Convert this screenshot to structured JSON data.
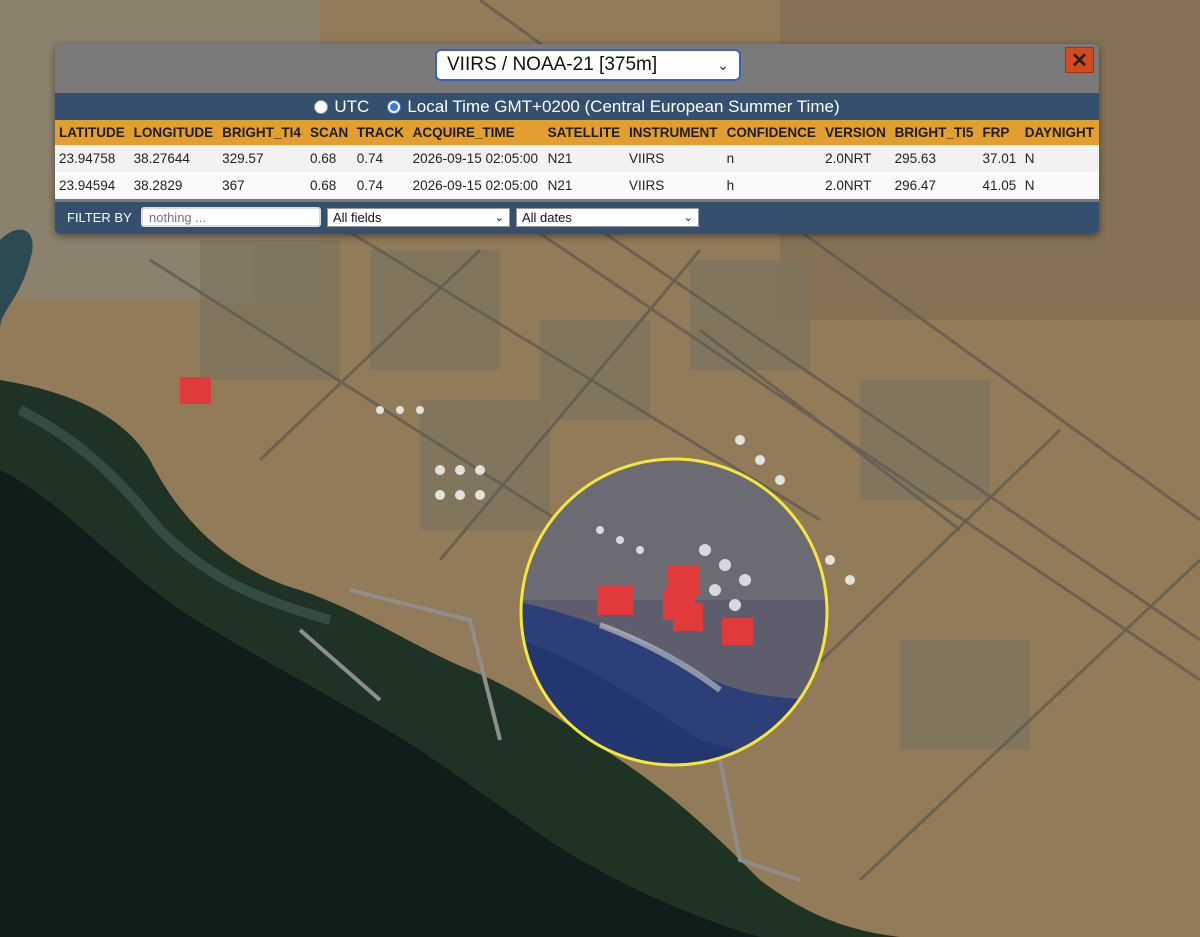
{
  "panel": {
    "source_select": "VIIRS / NOAA-21 [375m]",
    "close_label": "✕",
    "timezone": {
      "utc_label": "UTC",
      "local_label": "Local Time GMT+0200 (Central European Summer Time)",
      "selected": "local"
    },
    "table": {
      "columns": [
        "LATITUDE",
        "LONGITUDE",
        "BRIGHT_TI4",
        "SCAN",
        "TRACK",
        "ACQUIRE_TIME",
        "SATELLITE",
        "INSTRUMENT",
        "CONFIDENCE",
        "VERSION",
        "BRIGHT_TI5",
        "FRP",
        "DAYNIGHT"
      ],
      "rows": [
        [
          "23.94758",
          "38.27644",
          "329.57",
          "0.68",
          "0.74",
          "2026-09-15 02:05:00",
          "N21",
          "VIIRS",
          "n",
          "2.0NRT",
          "295.63",
          "37.01",
          "N"
        ],
        [
          "23.94594",
          "38.2829",
          "367",
          "0.68",
          "0.74",
          "2026-09-15 02:05:00",
          "N21",
          "VIIRS",
          "h",
          "2.0NRT",
          "296.47",
          "41.05",
          "N"
        ]
      ]
    },
    "filter": {
      "label": "FILTER BY",
      "placeholder": "nothing ...",
      "field_select": "All fields",
      "date_select": "All dates"
    }
  },
  "map": {
    "fire_marker_color": "#e03a3a",
    "highlight_ring_color": "#f4e63a",
    "fire_detections_in_inset": 5,
    "fire_detections_outside_inset": 1
  }
}
